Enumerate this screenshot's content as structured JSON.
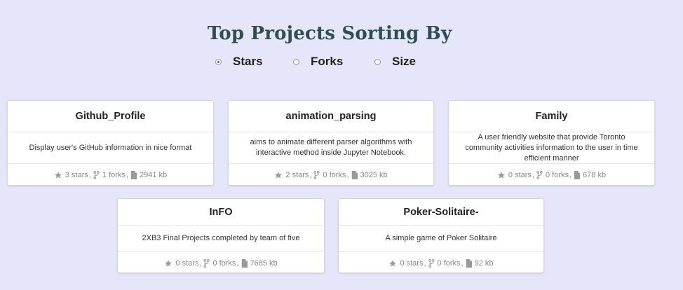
{
  "header": {
    "title": "Top Projects Sorting By"
  },
  "sort_options": [
    {
      "label": "Stars",
      "checked": true
    },
    {
      "label": "Forks",
      "checked": false
    },
    {
      "label": "Size",
      "checked": false
    }
  ],
  "projects": [
    {
      "name": "Github_Profile",
      "description": "Display user's GitHub information in nice format",
      "stars": "3 stars",
      "forks": "1 forks",
      "size": "2941 kb"
    },
    {
      "name": "animation_parsing",
      "description": "aims to animate different parser algorithms with interactive method inside Jupyter Notebook.",
      "stars": "2 stars",
      "forks": "0 forks",
      "size": "3025 kb"
    },
    {
      "name": "Family",
      "description": "A user friendly website that provide Toronto community activities information to the user in time efficient manner",
      "stars": "0 stars",
      "forks": "0 forks",
      "size": "678 kb"
    },
    {
      "name": "InFO",
      "description": "2XB3 Final Projects completed by team of five",
      "stars": "0 stars",
      "forks": "0 forks",
      "size": "7685 kb"
    },
    {
      "name": "Poker-Solitaire-",
      "description": "A simple game of Poker Solitaire",
      "stars": "0 stars",
      "forks": "0 forks",
      "size": "92 kb"
    }
  ],
  "meta": {
    "separator": ","
  },
  "icons": {
    "stars": "star-icon",
    "forks": "fork-icon",
    "size": "file-icon"
  },
  "colors": {
    "background": "#e6e6fa",
    "title": "#2f4f4f",
    "meta_text": "#888888"
  }
}
